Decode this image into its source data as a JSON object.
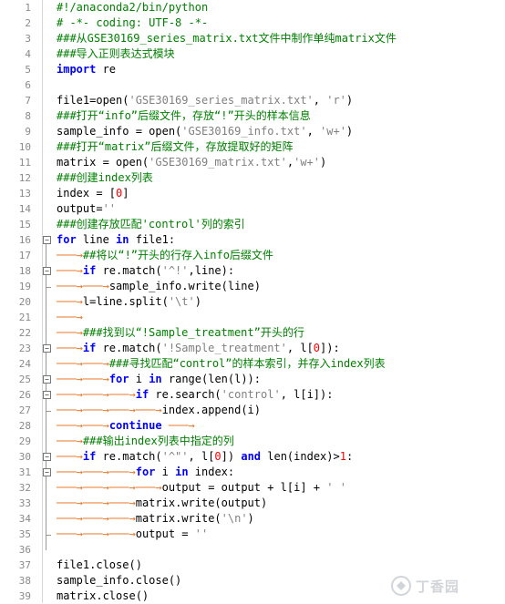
{
  "editor": {
    "line_numbers": [
      "1",
      "2",
      "3",
      "4",
      "5",
      "6",
      "7",
      "8",
      "9",
      "10",
      "11",
      "12",
      "13",
      "14",
      "15",
      "16",
      "17",
      "18",
      "19",
      "20",
      "21",
      "22",
      "23",
      "24",
      "25",
      "26",
      "27",
      "28",
      "29",
      "30",
      "31",
      "32",
      "33",
      "34",
      "35",
      "36",
      "37",
      "38",
      "39"
    ],
    "lines": [
      {
        "n": "1",
        "indent": 0,
        "segs": [
          {
            "t": "#!/anaconda2/bin/python",
            "c": "cm"
          }
        ]
      },
      {
        "n": "2",
        "indent": 0,
        "segs": [
          {
            "t": "# -*- coding: UTF-8 -*-",
            "c": "cm"
          }
        ]
      },
      {
        "n": "3",
        "indent": 0,
        "segs": [
          {
            "t": "###从GSE30169_series_matrix.txt文件中制作单纯matrix文件",
            "c": "cm"
          }
        ]
      },
      {
        "n": "4",
        "indent": 0,
        "segs": [
          {
            "t": "###导入正则表达式模块",
            "c": "cm"
          }
        ]
      },
      {
        "n": "5",
        "indent": 0,
        "segs": [
          {
            "t": "import",
            "c": "kw"
          },
          {
            "t": " re",
            "c": ""
          }
        ]
      },
      {
        "n": "6",
        "indent": 0,
        "segs": []
      },
      {
        "n": "7",
        "indent": 0,
        "segs": [
          {
            "t": "file1=open(",
            "c": ""
          },
          {
            "t": "'GSE30169_series_matrix.txt'",
            "c": "st"
          },
          {
            "t": ", ",
            "c": ""
          },
          {
            "t": "'r'",
            "c": "st"
          },
          {
            "t": ")",
            "c": ""
          }
        ]
      },
      {
        "n": "8",
        "indent": 0,
        "segs": [
          {
            "t": "###打开“info”后缀文件，存放“!”开头的样本信息",
            "c": "cm"
          }
        ]
      },
      {
        "n": "9",
        "indent": 0,
        "segs": [
          {
            "t": "sample_info = open(",
            "c": ""
          },
          {
            "t": "'GSE30169_info.txt'",
            "c": "st"
          },
          {
            "t": ", ",
            "c": ""
          },
          {
            "t": "'w+'",
            "c": "st"
          },
          {
            "t": ")",
            "c": ""
          }
        ]
      },
      {
        "n": "10",
        "indent": 0,
        "segs": [
          {
            "t": "###打开“matrix”后缀文件，存放提取好的矩阵",
            "c": "cm"
          }
        ]
      },
      {
        "n": "11",
        "indent": 0,
        "segs": [
          {
            "t": "matrix = open(",
            "c": ""
          },
          {
            "t": "'GSE30169_matrix.txt'",
            "c": "st"
          },
          {
            "t": ",",
            "c": ""
          },
          {
            "t": "'w+'",
            "c": "st"
          },
          {
            "t": ")",
            "c": ""
          }
        ]
      },
      {
        "n": "12",
        "indent": 0,
        "segs": [
          {
            "t": "###创建index列表",
            "c": "cm"
          }
        ]
      },
      {
        "n": "13",
        "indent": 0,
        "segs": [
          {
            "t": "index = [",
            "c": ""
          },
          {
            "t": "0",
            "c": "nm"
          },
          {
            "t": "]",
            "c": ""
          }
        ]
      },
      {
        "n": "14",
        "indent": 0,
        "segs": [
          {
            "t": "output=",
            "c": ""
          },
          {
            "t": "''",
            "c": "st"
          }
        ]
      },
      {
        "n": "15",
        "indent": 0,
        "segs": [
          {
            "t": "###创建存放匹配'control'列的索引",
            "c": "cm"
          }
        ]
      },
      {
        "n": "16",
        "indent": 0,
        "segs": [
          {
            "t": "for",
            "c": "kw"
          },
          {
            "t": " line ",
            "c": ""
          },
          {
            "t": "in",
            "c": "kw"
          },
          {
            "t": " file1:",
            "c": ""
          }
        ]
      },
      {
        "n": "17",
        "indent": 1,
        "segs": [
          {
            "t": "##将以“!”开头的行存入info后缀文件",
            "c": "cm"
          }
        ]
      },
      {
        "n": "18",
        "indent": 1,
        "segs": [
          {
            "t": "if",
            "c": "kw"
          },
          {
            "t": " re.match(",
            "c": ""
          },
          {
            "t": "'^!'",
            "c": "st"
          },
          {
            "t": ",line):",
            "c": ""
          }
        ]
      },
      {
        "n": "19",
        "indent": 2,
        "segs": [
          {
            "t": "sample_info.write(line)",
            "c": ""
          }
        ]
      },
      {
        "n": "20",
        "indent": 1,
        "segs": [
          {
            "t": "l=line.split(",
            "c": ""
          },
          {
            "t": "'\\t'",
            "c": "st"
          },
          {
            "t": ")",
            "c": ""
          }
        ]
      },
      {
        "n": "21",
        "indent": 1,
        "segs": []
      },
      {
        "n": "22",
        "indent": 1,
        "segs": [
          {
            "t": "###找到以“!Sample_treatment”开头的行",
            "c": "cm"
          }
        ]
      },
      {
        "n": "23",
        "indent": 1,
        "segs": [
          {
            "t": "if",
            "c": "kw"
          },
          {
            "t": " re.match(",
            "c": ""
          },
          {
            "t": "'!Sample_treatment'",
            "c": "st"
          },
          {
            "t": ", l[",
            "c": ""
          },
          {
            "t": "0",
            "c": "nm"
          },
          {
            "t": "]):",
            "c": ""
          }
        ]
      },
      {
        "n": "24",
        "indent": 2,
        "segs": [
          {
            "t": "###寻找匹配“control”的样本索引，并存入index列表",
            "c": "cm"
          }
        ]
      },
      {
        "n": "25",
        "indent": 2,
        "segs": [
          {
            "t": "for",
            "c": "kw"
          },
          {
            "t": " i ",
            "c": ""
          },
          {
            "t": "in",
            "c": "kw"
          },
          {
            "t": " range(len(l)):",
            "c": ""
          }
        ]
      },
      {
        "n": "26",
        "indent": 3,
        "segs": [
          {
            "t": "if",
            "c": "kw"
          },
          {
            "t": " re.search(",
            "c": ""
          },
          {
            "t": "'control'",
            "c": "st"
          },
          {
            "t": ", l[i]):",
            "c": ""
          }
        ]
      },
      {
        "n": "27",
        "indent": 4,
        "segs": [
          {
            "t": "index.append(i)",
            "c": ""
          }
        ]
      },
      {
        "n": "28",
        "indent": 2,
        "segs": [
          {
            "t": "continue",
            "c": "kw"
          },
          {
            "t": " ───→",
            "c": "arrow"
          }
        ]
      },
      {
        "n": "29",
        "indent": 1,
        "segs": [
          {
            "t": "###输出index列表中指定的列",
            "c": "cm"
          }
        ]
      },
      {
        "n": "30",
        "indent": 1,
        "segs": [
          {
            "t": "if",
            "c": "kw"
          },
          {
            "t": " re.match(",
            "c": ""
          },
          {
            "t": "'^\"'",
            "c": "st"
          },
          {
            "t": ", l[",
            "c": ""
          },
          {
            "t": "0",
            "c": "nm"
          },
          {
            "t": "]) ",
            "c": ""
          },
          {
            "t": "and",
            "c": "kw"
          },
          {
            "t": " len(index)>",
            "c": ""
          },
          {
            "t": "1",
            "c": "nm"
          },
          {
            "t": ":",
            "c": ""
          }
        ]
      },
      {
        "n": "31",
        "indent": 3,
        "segs": [
          {
            "t": "for",
            "c": "kw"
          },
          {
            "t": " i ",
            "c": ""
          },
          {
            "t": "in",
            "c": "kw"
          },
          {
            "t": " index:",
            "c": ""
          }
        ]
      },
      {
        "n": "32",
        "indent": 4,
        "segs": [
          {
            "t": "output = output + l[i] + ",
            "c": ""
          },
          {
            "t": "' '",
            "c": "st"
          }
        ]
      },
      {
        "n": "33",
        "indent": 3,
        "segs": [
          {
            "t": "matrix.write(output)",
            "c": ""
          }
        ]
      },
      {
        "n": "34",
        "indent": 3,
        "segs": [
          {
            "t": "matrix.write(",
            "c": ""
          },
          {
            "t": "'\\n'",
            "c": "st"
          },
          {
            "t": ")",
            "c": ""
          }
        ]
      },
      {
        "n": "35",
        "indent": 3,
        "segs": [
          {
            "t": "output = ",
            "c": ""
          },
          {
            "t": "''",
            "c": "st"
          }
        ]
      },
      {
        "n": "36",
        "indent": 0,
        "segs": []
      },
      {
        "n": "37",
        "indent": 0,
        "segs": [
          {
            "t": "file1.close()",
            "c": ""
          }
        ]
      },
      {
        "n": "38",
        "indent": 0,
        "segs": [
          {
            "t": "sample_info.close()",
            "c": ""
          }
        ]
      },
      {
        "n": "39",
        "indent": 0,
        "segs": [
          {
            "t": "matrix.close()",
            "c": ""
          }
        ]
      }
    ]
  },
  "watermark": {
    "text": "丁香园",
    "icon": "dxy-logo-icon",
    "color": "#9aa3ad"
  },
  "colors": {
    "comment": "#008000",
    "keyword": "#0000ff",
    "string": "#808080",
    "number": "#ff0000",
    "tab_arrow": "#e87a2c",
    "line_number": "#8a8a8a"
  }
}
